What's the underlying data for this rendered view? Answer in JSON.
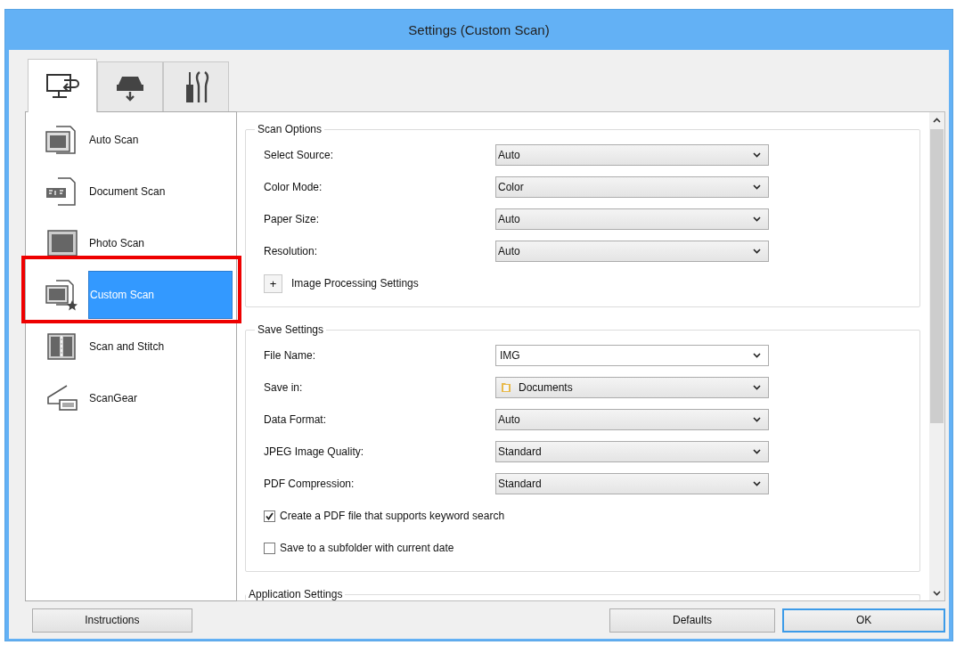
{
  "window": {
    "title": "Settings (Custom Scan)"
  },
  "tabs": [
    {
      "kind": "computer",
      "selected": true
    },
    {
      "kind": "scanner",
      "selected": false
    },
    {
      "kind": "tools",
      "selected": false
    }
  ],
  "sidebar": {
    "items": [
      {
        "kind": "auto",
        "label": "Auto Scan",
        "selected": false,
        "highlighted": false
      },
      {
        "kind": "document",
        "label": "Document Scan",
        "selected": false,
        "highlighted": false
      },
      {
        "kind": "photo",
        "label": "Photo Scan",
        "selected": false,
        "highlighted": false
      },
      {
        "kind": "custom",
        "label": "Custom Scan",
        "selected": true,
        "highlighted": true
      },
      {
        "kind": "stitch",
        "label": "Scan and Stitch",
        "selected": false,
        "highlighted": false
      },
      {
        "kind": "scangear",
        "label": "ScanGear",
        "selected": false,
        "highlighted": false
      }
    ]
  },
  "sections": [
    {
      "title": "Scan Options",
      "fields": [
        {
          "kind": "select",
          "label": "Select Source:",
          "value": "Auto"
        },
        {
          "kind": "select",
          "label": "Color Mode:",
          "value": "Color"
        },
        {
          "kind": "select",
          "label": "Paper Size:",
          "value": "Auto"
        },
        {
          "kind": "select",
          "label": "Resolution:",
          "value": "Auto"
        },
        {
          "kind": "expander",
          "label": "Image Processing Settings",
          "symbol": "+"
        }
      ]
    },
    {
      "title": "Save Settings",
      "fields": [
        {
          "kind": "combo",
          "label": "File Name:",
          "value": "IMG"
        },
        {
          "kind": "folder",
          "label": "Save in:",
          "value": "Documents"
        },
        {
          "kind": "select",
          "label": "Data Format:",
          "value": "Auto"
        },
        {
          "kind": "select",
          "label": "JPEG Image Quality:",
          "value": "Standard"
        },
        {
          "kind": "select",
          "label": "PDF Compression:",
          "value": "Standard"
        },
        {
          "kind": "checkbox",
          "label": "Create a PDF file that supports keyword search",
          "checked": true
        },
        {
          "kind": "checkbox",
          "label": "Save to a subfolder with current date",
          "checked": false
        }
      ]
    },
    {
      "title": "Application Settings"
    }
  ],
  "buttons": [
    {
      "label": "Instructions",
      "default": false
    },
    {
      "label": "Defaults",
      "default": false
    },
    {
      "label": "OK",
      "default": true
    }
  ]
}
